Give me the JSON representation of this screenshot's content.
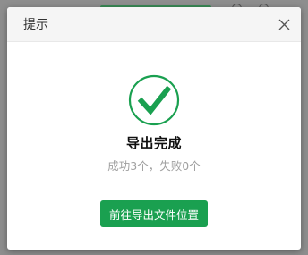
{
  "dialog": {
    "title": "提示",
    "close_icon": "close-icon"
  },
  "result": {
    "icon": "check-circle-icon",
    "title": "导出完成",
    "summary": "成功3个，失败0个"
  },
  "actions": {
    "open_location_label": "前往导出文件位置"
  },
  "colors": {
    "success": "#1aa050",
    "overlay": "#8e8e8e"
  }
}
